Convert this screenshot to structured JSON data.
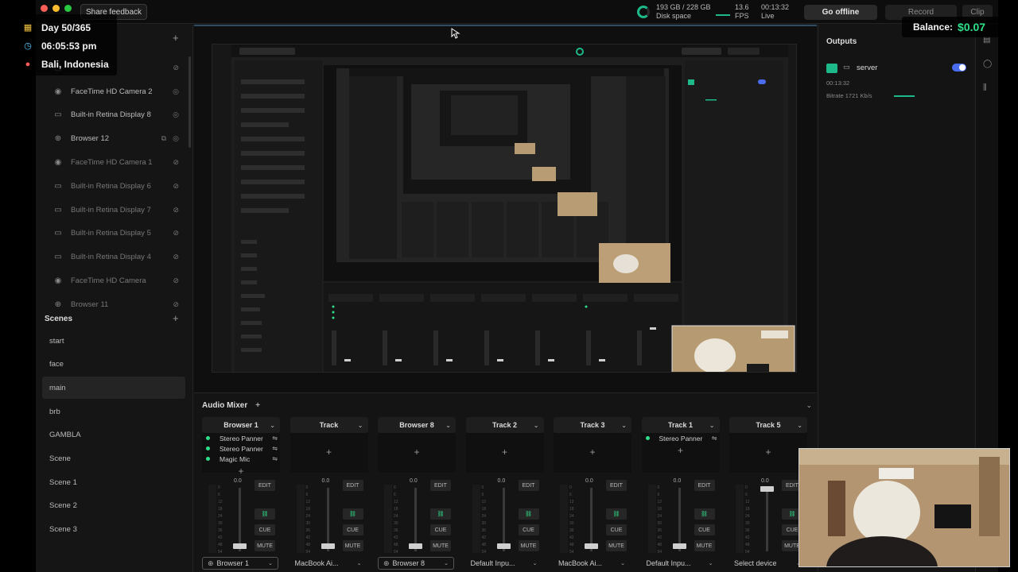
{
  "topbar": {
    "feedback_label": "Share feedback",
    "disk_used": "193 GB / 228 GB",
    "disk_label": "Disk space",
    "fps_value": "13.6",
    "fps_label": "FPS",
    "live_time": "00:13:32",
    "live_label": "Live",
    "go_offline_label": "Go offline",
    "record_label": "Record",
    "clip_label": "Clip"
  },
  "layers": {
    "items": [
      {
        "label": "FaceTime HD Camera 2",
        "icon": "camera-icon",
        "dim": false
      },
      {
        "label": "Built-in Retina Display 8",
        "icon": "monitor-icon",
        "dim": false
      },
      {
        "label": "Browser 12",
        "icon": "globe-icon",
        "dim": false
      },
      {
        "label": "FaceTime HD Camera 1",
        "icon": "camera-icon",
        "dim": true
      },
      {
        "label": "Built-in Retina Display 6",
        "icon": "monitor-icon",
        "dim": true
      },
      {
        "label": "Built-in Retina Display 7",
        "icon": "monitor-icon",
        "dim": true
      },
      {
        "label": "Built-in Retina Display 5",
        "icon": "monitor-icon",
        "dim": true
      },
      {
        "label": "Built-in Retina Display 4",
        "icon": "monitor-icon",
        "dim": true
      },
      {
        "label": "FaceTime HD Camera",
        "icon": "camera-icon",
        "dim": true
      },
      {
        "label": "Browser 11",
        "icon": "globe-icon",
        "dim": true
      }
    ]
  },
  "scenes": {
    "heading": "Scenes",
    "items": [
      "start",
      "face",
      "main",
      "brb",
      "GAMBLA",
      "Scene",
      "Scene 1",
      "Scene 2",
      "Scene 3"
    ],
    "active": "main"
  },
  "mixer": {
    "heading": "Audio Mixer",
    "channels": [
      {
        "name": "Browser 1",
        "fx": [
          "Stereo Panner",
          "Stereo Panner",
          "Magic Mic"
        ],
        "device": "Browser 1",
        "boxed": true,
        "db": "0.0"
      },
      {
        "name": "Track",
        "fx": [],
        "device": "MacBook Ai...",
        "boxed": false,
        "db": "0.0"
      },
      {
        "name": "Browser 8",
        "fx": [],
        "device": "Browser 8",
        "boxed": true,
        "db": "0.0"
      },
      {
        "name": "Track 2",
        "fx": [],
        "device": "Default Inpu...",
        "boxed": false,
        "db": "0.0"
      },
      {
        "name": "Track 3",
        "fx": [],
        "device": "MacBook Ai...",
        "boxed": false,
        "db": "0.0"
      },
      {
        "name": "Track 1",
        "fx": [
          "Stereo Panner"
        ],
        "device": "Default Inpu...",
        "boxed": false,
        "db": "0.0"
      },
      {
        "name": "Track 5",
        "fx": [],
        "device": "Select device",
        "boxed": false,
        "db": "0.0"
      }
    ],
    "edit_label": "EDIT",
    "cue_label": "CUE",
    "mute_label": "MUTE"
  },
  "outputs": {
    "heading": "Outputs",
    "server_name": "server",
    "server_time": "00:13:32",
    "bitrate": "Bitrate   1721 Kb/s"
  },
  "overlay": {
    "day": "Day 50/365",
    "time": "06:05:53 pm",
    "location": "Bali, Indonesia",
    "balance_label": "Balance:",
    "balance_value": "$0.07"
  },
  "colors": {
    "accent_green": "#2ee08a",
    "toggle_blue": "#4a6df0",
    "balance_green": "#2ee08a"
  }
}
